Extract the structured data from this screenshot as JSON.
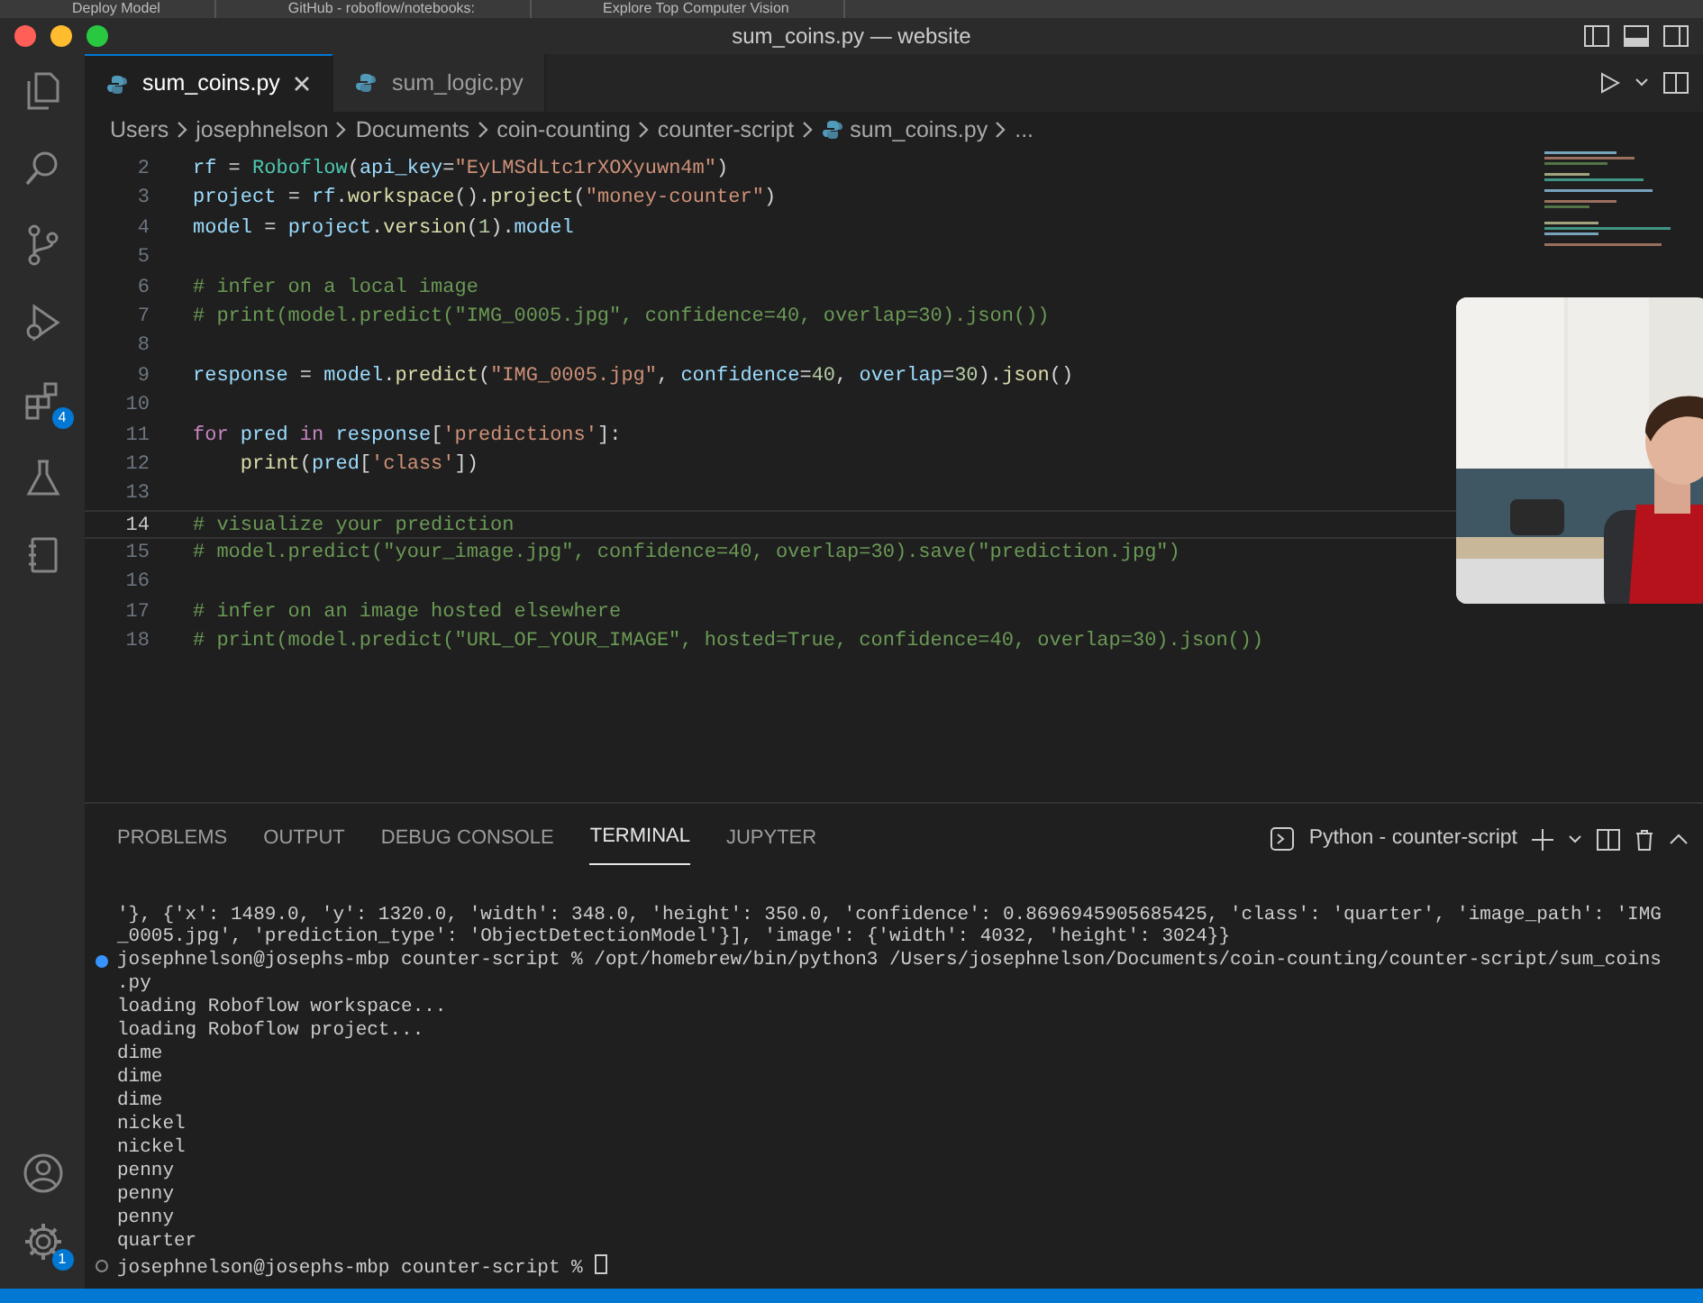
{
  "browser_tabs": [
    {
      "label": "Deploy Model"
    },
    {
      "label": "GitHub - roboflow/notebooks:"
    },
    {
      "label": "Explore Top Computer Vision"
    }
  ],
  "window": {
    "title": "sum_coins.py — website"
  },
  "activity_bar": [
    {
      "kind": "files",
      "selected": false
    },
    {
      "kind": "search",
      "selected": false
    },
    {
      "kind": "source-control",
      "selected": false
    },
    {
      "kind": "run-debug",
      "selected": false
    },
    {
      "kind": "extensions",
      "selected": false,
      "badge": "4"
    },
    {
      "kind": "testing",
      "selected": false
    },
    {
      "kind": "notebook",
      "selected": false
    }
  ],
  "activity_bottom": [
    {
      "kind": "account"
    },
    {
      "kind": "settings",
      "badge": "1"
    }
  ],
  "editor_tabs": [
    {
      "label": "sum_coins.py",
      "selected": true
    },
    {
      "label": "sum_logic.py",
      "selected": false
    }
  ],
  "breadcrumbs": [
    {
      "label": "Users",
      "kind": "folder"
    },
    {
      "label": "josephnelson",
      "kind": "folder"
    },
    {
      "label": "Documents",
      "kind": "folder"
    },
    {
      "label": "coin-counting",
      "kind": "folder"
    },
    {
      "label": "counter-script",
      "kind": "folder"
    },
    {
      "label": "sum_coins.py",
      "kind": "file"
    },
    {
      "label": "...",
      "kind": "more"
    }
  ],
  "code_lines": [
    {
      "number": "2",
      "current": false,
      "tokens": [
        {
          "kind": "variable",
          "text": "rf"
        },
        {
          "kind": "plain",
          "text": " = "
        },
        {
          "kind": "class",
          "text": "Roboflow"
        },
        {
          "kind": "plain",
          "text": "("
        },
        {
          "kind": "variable",
          "text": "api_key"
        },
        {
          "kind": "plain",
          "text": "="
        },
        {
          "kind": "string",
          "text": "\"EyLMSdLtc1rXOXyuwn4m\""
        },
        {
          "kind": "plain",
          "text": ")"
        }
      ]
    },
    {
      "number": "3",
      "current": false,
      "tokens": [
        {
          "kind": "variable",
          "text": "project"
        },
        {
          "kind": "plain",
          "text": " = "
        },
        {
          "kind": "variable",
          "text": "rf"
        },
        {
          "kind": "plain",
          "text": "."
        },
        {
          "kind": "function",
          "text": "workspace"
        },
        {
          "kind": "plain",
          "text": "()."
        },
        {
          "kind": "function",
          "text": "project"
        },
        {
          "kind": "plain",
          "text": "("
        },
        {
          "kind": "string",
          "text": "\"money-counter\""
        },
        {
          "kind": "plain",
          "text": ")"
        }
      ]
    },
    {
      "number": "4",
      "current": false,
      "tokens": [
        {
          "kind": "variable",
          "text": "model"
        },
        {
          "kind": "plain",
          "text": " = "
        },
        {
          "kind": "variable",
          "text": "project"
        },
        {
          "kind": "plain",
          "text": "."
        },
        {
          "kind": "function",
          "text": "version"
        },
        {
          "kind": "plain",
          "text": "("
        },
        {
          "kind": "number",
          "text": "1"
        },
        {
          "kind": "plain",
          "text": ")."
        },
        {
          "kind": "variable",
          "text": "model"
        }
      ]
    },
    {
      "number": "5",
      "current": false
    },
    {
      "number": "6",
      "current": false,
      "tokens": [
        {
          "kind": "comment",
          "text": "# infer on a local image"
        }
      ]
    },
    {
      "number": "7",
      "current": false,
      "tokens": [
        {
          "kind": "comment",
          "text": "# print(model.predict(\"IMG_0005.jpg\", confidence=40, overlap=30).json())"
        }
      ]
    },
    {
      "number": "8",
      "current": false
    },
    {
      "number": "9",
      "current": false,
      "tokens": [
        {
          "kind": "variable",
          "text": "response"
        },
        {
          "kind": "plain",
          "text": " = "
        },
        {
          "kind": "variable",
          "text": "model"
        },
        {
          "kind": "plain",
          "text": "."
        },
        {
          "kind": "function",
          "text": "predict"
        },
        {
          "kind": "plain",
          "text": "("
        },
        {
          "kind": "string",
          "text": "\"IMG_0005.jpg\""
        },
        {
          "kind": "plain",
          "text": ", "
        },
        {
          "kind": "variable",
          "text": "confidence"
        },
        {
          "kind": "plain",
          "text": "="
        },
        {
          "kind": "number",
          "text": "40"
        },
        {
          "kind": "plain",
          "text": ", "
        },
        {
          "kind": "variable",
          "text": "overlap"
        },
        {
          "kind": "plain",
          "text": "="
        },
        {
          "kind": "number",
          "text": "30"
        },
        {
          "kind": "plain",
          "text": ")."
        },
        {
          "kind": "function",
          "text": "json"
        },
        {
          "kind": "plain",
          "text": "()"
        }
      ]
    },
    {
      "number": "10",
      "current": false
    },
    {
      "number": "11",
      "current": false,
      "tokens": [
        {
          "kind": "keyword",
          "text": "for"
        },
        {
          "kind": "variable",
          "text": " pred"
        },
        {
          "kind": "keyword",
          "text": " in"
        },
        {
          "kind": "variable",
          "text": " response"
        },
        {
          "kind": "plain",
          "text": "["
        },
        {
          "kind": "string",
          "text": "'predictions'"
        },
        {
          "kind": "plain",
          "text": "]:"
        }
      ]
    },
    {
      "number": "12",
      "current": false,
      "tokens": [
        {
          "kind": "function",
          "text": "    print"
        },
        {
          "kind": "plain",
          "text": "("
        },
        {
          "kind": "variable",
          "text": "pred"
        },
        {
          "kind": "plain",
          "text": "["
        },
        {
          "kind": "string",
          "text": "'class'"
        },
        {
          "kind": "plain",
          "text": "])"
        }
      ]
    },
    {
      "number": "13",
      "current": false
    },
    {
      "number": "14",
      "current": true,
      "tokens": [
        {
          "kind": "comment",
          "text": "# visualize your prediction"
        }
      ]
    },
    {
      "number": "15",
      "current": false,
      "tokens": [
        {
          "kind": "comment",
          "text": "# model.predict(\"your_image.jpg\", confidence=40, overlap=30).save(\"prediction.jpg\")"
        }
      ]
    },
    {
      "number": "16",
      "current": false
    },
    {
      "number": "17",
      "current": false,
      "tokens": [
        {
          "kind": "comment",
          "text": "# infer on an image hosted elsewhere"
        }
      ]
    },
    {
      "number": "18",
      "current": false,
      "tokens": [
        {
          "kind": "comment",
          "text": "# print(model.predict(\"URL_OF_YOUR_IMAGE\", hosted=True, confidence=40, overlap=30).json())"
        }
      ]
    }
  ],
  "panel_tabs": [
    {
      "label": "PROBLEMS",
      "selected": false
    },
    {
      "label": "OUTPUT",
      "selected": false
    },
    {
      "label": "DEBUG CONSOLE",
      "selected": false
    },
    {
      "label": "TERMINAL",
      "selected": true
    },
    {
      "label": "JUPYTER",
      "selected": false
    }
  ],
  "terminal_name": "Python - counter-script",
  "terminal_lines": [
    {
      "kind": "output",
      "text": "'}, {'x': 1489.0, 'y': 1320.0, 'width': 348.0, 'height': 350.0, 'confidence': 0.8696945905685425, 'class': 'quarter', 'image_path': 'IMG"
    },
    {
      "kind": "output",
      "text": "_0005.jpg', 'prediction_type': 'ObjectDetectionModel'}], 'image': {'width': 4032, 'height': 3024}}"
    },
    {
      "kind": "prompt-done",
      "text": "josephnelson@josephs-mbp counter-script % /opt/homebrew/bin/python3 /Users/josephnelson/Documents/coin-counting/counter-script/sum_coins"
    },
    {
      "kind": "output",
      "text": ".py"
    },
    {
      "kind": "output",
      "text": "loading Roboflow workspace..."
    },
    {
      "kind": "output",
      "text": "loading Roboflow project..."
    },
    {
      "kind": "output",
      "text": "dime"
    },
    {
      "kind": "output",
      "text": "dime"
    },
    {
      "kind": "output",
      "text": "dime"
    },
    {
      "kind": "output",
      "text": "nickel"
    },
    {
      "kind": "output",
      "text": "nickel"
    },
    {
      "kind": "output",
      "text": "penny"
    },
    {
      "kind": "output",
      "text": "penny"
    },
    {
      "kind": "output",
      "text": "penny"
    },
    {
      "kind": "output",
      "text": "quarter"
    },
    {
      "kind": "prompt-waiting",
      "text": "josephnelson@josephs-mbp counter-script % "
    }
  ]
}
